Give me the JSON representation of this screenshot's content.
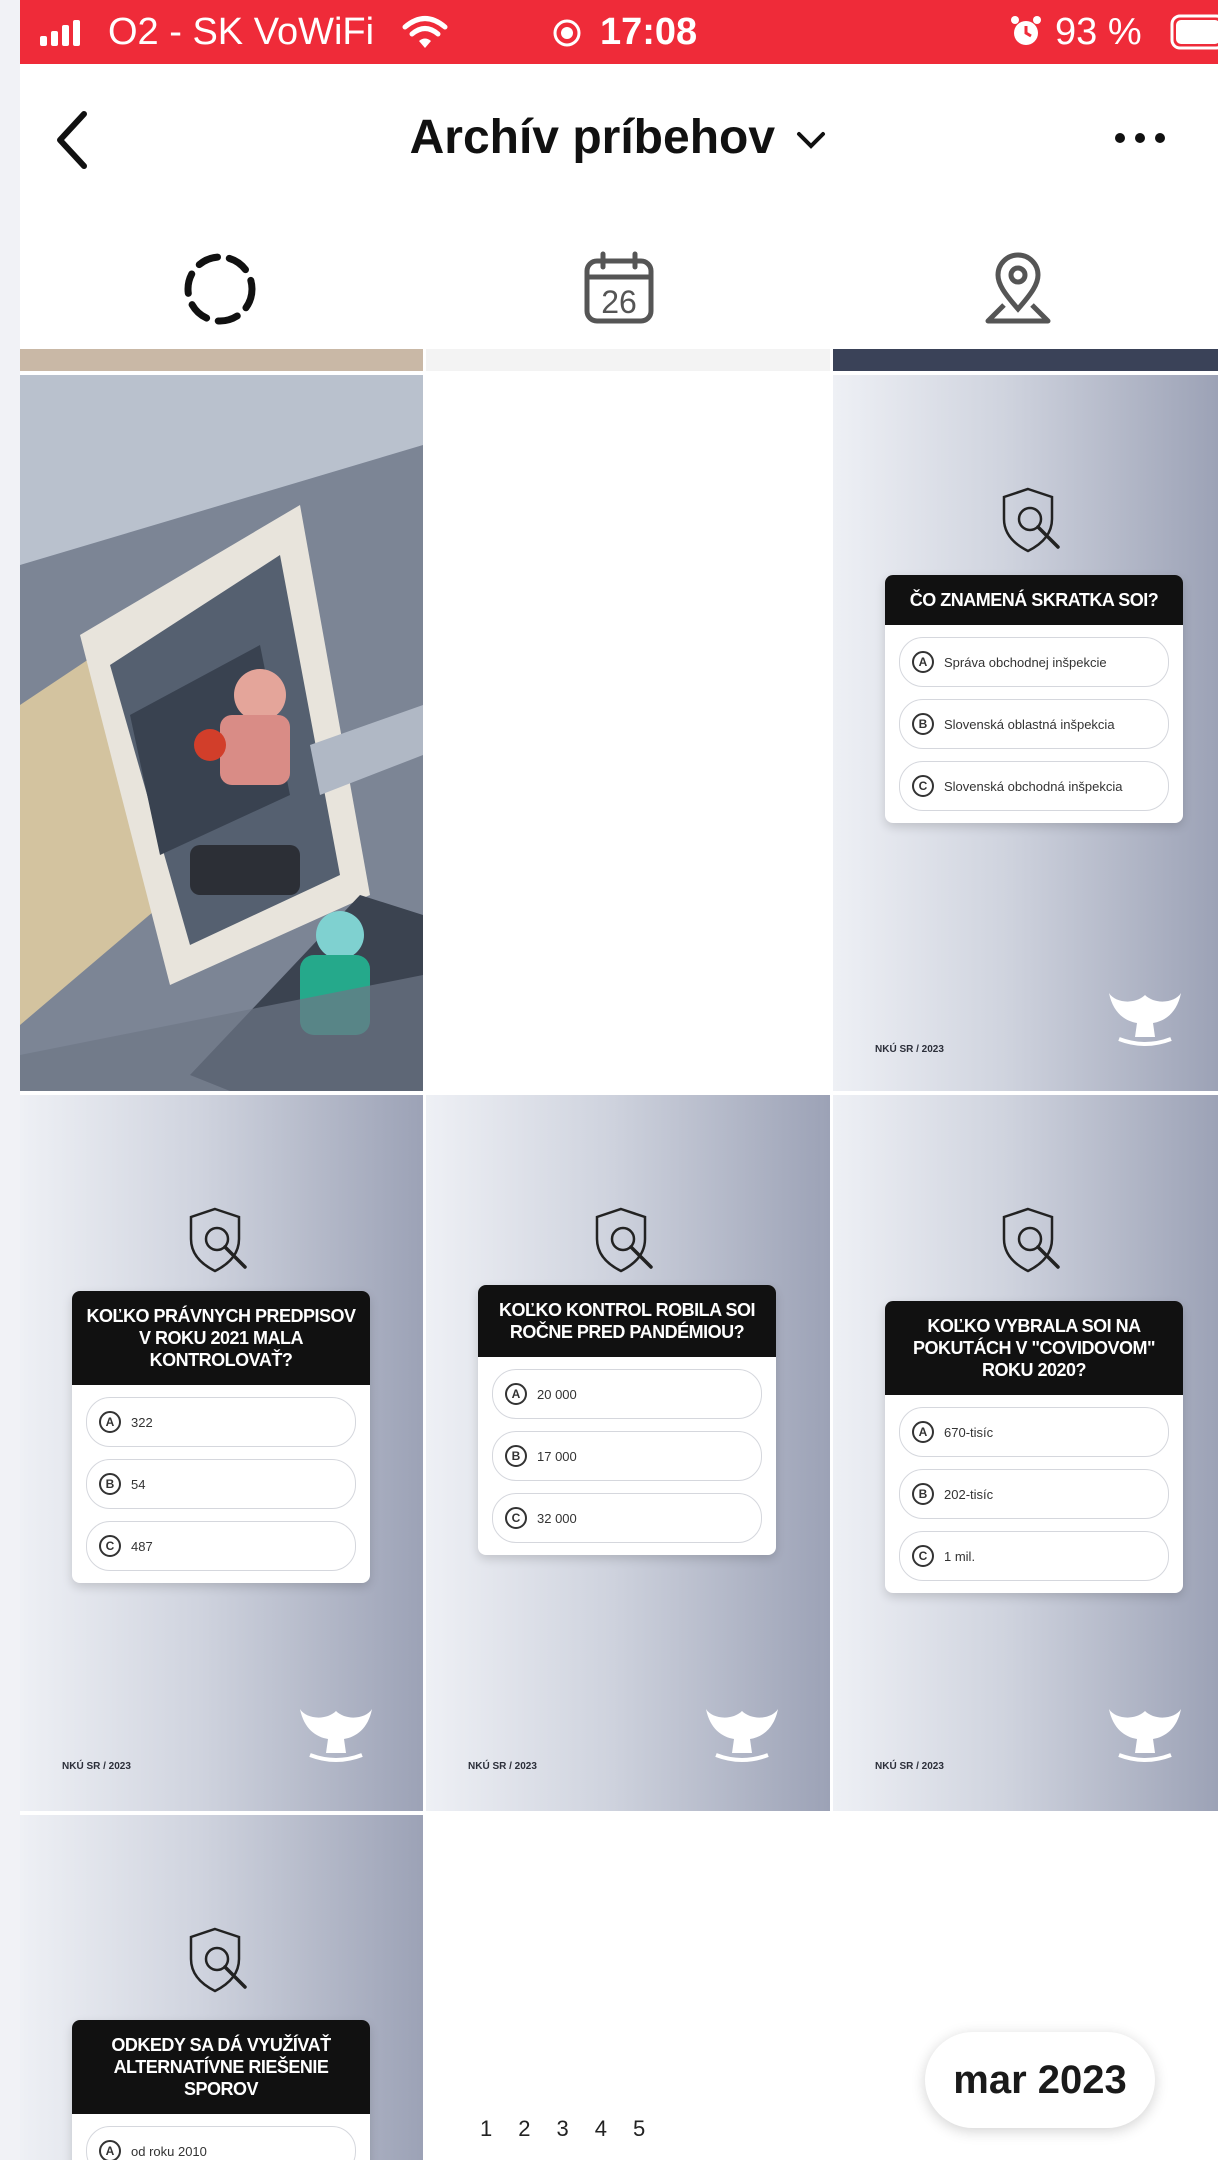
{
  "status_bar": {
    "carrier": "O2 - SK VoWiFi",
    "time": "17:08",
    "battery": "93 %",
    "icons": [
      "signal-icon",
      "wifi-icon",
      "location-icon",
      "alarm-icon",
      "battery-icon"
    ]
  },
  "header": {
    "title": "Archív príbehov",
    "icons": [
      "back-icon",
      "chevron-down-icon",
      "more-icon"
    ]
  },
  "tabs": {
    "calendar_day": "26",
    "items": [
      "stories-tab",
      "calendar-tab",
      "location-tab"
    ]
  },
  "stories": {
    "footer": "NKÚ SR / 2023",
    "cards": [
      {
        "question": "ČO ZNAMENÁ SKRATKA SOI?",
        "options": [
          {
            "letter": "A",
            "text": "Správa obchodnej inšpekcie"
          },
          {
            "letter": "B",
            "text": "Slovenská oblastná inšpekcia"
          },
          {
            "letter": "C",
            "text": "Slovenská obchodná inšpekcia"
          }
        ]
      },
      {
        "question": "KOĽKO PRÁVNYCH PREDPISOV V ROKU 2021 MALA KONTROLOVAŤ?",
        "options": [
          {
            "letter": "A",
            "text": "322"
          },
          {
            "letter": "B",
            "text": "54"
          },
          {
            "letter": "C",
            "text": "487"
          }
        ]
      },
      {
        "question": "KOĽKO KONTROL ROBILA SOI ROČNE PRED PANDÉMIOU?",
        "options": [
          {
            "letter": "A",
            "text": "20 000"
          },
          {
            "letter": "B",
            "text": "17 000"
          },
          {
            "letter": "C",
            "text": "32 000"
          }
        ]
      },
      {
        "question": "KOĽKO VYBRALA SOI NA POKUTÁCH V \"COVIDOVOM\" ROKU 2020?",
        "options": [
          {
            "letter": "A",
            "text": "670-tisíc"
          },
          {
            "letter": "B",
            "text": "202-tisíc"
          },
          {
            "letter": "C",
            "text": "1 mil."
          }
        ]
      },
      {
        "question": "ODKEDY SA DÁ VYUŽÍVAŤ ALTERNATÍVNE RIEŠENIE SPOROV",
        "options": [
          {
            "letter": "A",
            "text": "od roku 2010"
          }
        ]
      }
    ]
  },
  "month_pill": "mar 2023",
  "page_numbers": [
    "1",
    "2",
    "3",
    "4",
    "5"
  ]
}
